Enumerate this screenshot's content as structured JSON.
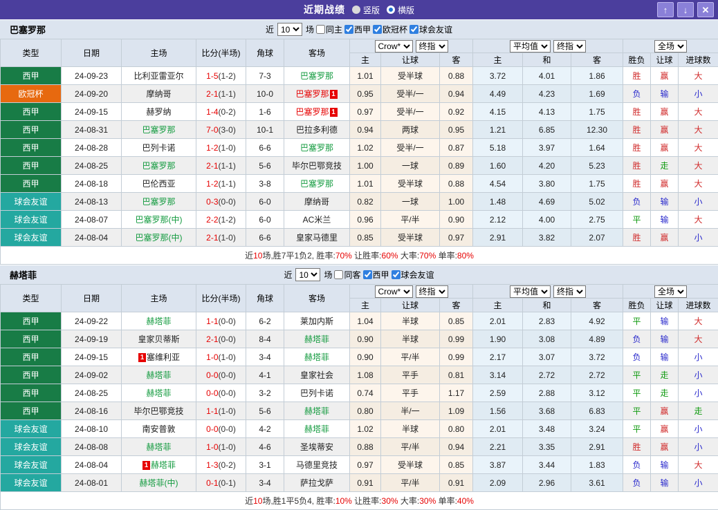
{
  "titlebar": {
    "title": "近期战绩",
    "view_options": [
      {
        "label": "竖版",
        "selected": false
      },
      {
        "label": "横版",
        "selected": true
      }
    ],
    "buttons": {
      "up": "↑",
      "down": "↓",
      "close": "✕"
    }
  },
  "colors": {
    "titlebar_bg": "#4b3e9d",
    "header_bg": "#dce4ef",
    "league": {
      "西甲": "#187c46",
      "欧冠杯": "#e7690f",
      "球会友谊": "#24a8a0"
    },
    "team_green": "#129a3e",
    "team_red": "#e60000",
    "score_red": "#e60000",
    "win_red": "#d02b2b",
    "lose_blue": "#2929cc",
    "draw_green": "#0f9a0f"
  },
  "table_header": {
    "static": [
      "类型",
      "日期",
      "主场",
      "比分(半场)",
      "角球",
      "客场"
    ],
    "group1_selects": [
      "Crow*",
      "终指"
    ],
    "group2_selects": [
      "平均值",
      "终指"
    ],
    "group3_select": "全场",
    "sub": [
      "主",
      "让球",
      "客",
      "主",
      "和",
      "客",
      "胜负",
      "让球",
      "进球数"
    ]
  },
  "filter_labels": {
    "near": "近",
    "count": "10",
    "games": "场"
  },
  "sections": [
    {
      "team": "巴塞罗那",
      "filter": {
        "same": {
          "label": "同主",
          "checked": false
        },
        "leagues": [
          {
            "label": "西甲",
            "checked": true
          },
          {
            "label": "欧冠杯",
            "checked": true
          },
          {
            "label": "球会友谊",
            "checked": true
          }
        ]
      },
      "rows": [
        {
          "league": "西甲",
          "date": "24-09-23",
          "home": {
            "text": "比利亚雷亚尔",
            "color": "black"
          },
          "score_full": "1-5",
          "score_half": "(1-2)",
          "corner": "7-3",
          "away": {
            "text": "巴塞罗那",
            "color": "green"
          },
          "odds": [
            "1.01",
            "受半球",
            "0.88"
          ],
          "avg": [
            "3.72",
            "4.01",
            "1.86"
          ],
          "verdict": [
            {
              "t": "胜",
              "c": "red"
            },
            {
              "t": "赢",
              "c": "red"
            },
            {
              "t": "大",
              "c": "red"
            }
          ]
        },
        {
          "league": "欧冠杯",
          "date": "24-09-20",
          "home": {
            "text": "摩纳哥",
            "color": "black"
          },
          "score_full": "2-1",
          "score_half": "(1-1)",
          "corner": "10-0",
          "away": {
            "text": "巴塞罗那",
            "color": "red",
            "badge": "1",
            "badge_pos": "after"
          },
          "odds": [
            "0.95",
            "受半/一",
            "0.94"
          ],
          "avg": [
            "4.49",
            "4.23",
            "1.69"
          ],
          "verdict": [
            {
              "t": "负",
              "c": "blue"
            },
            {
              "t": "输",
              "c": "blue"
            },
            {
              "t": "小",
              "c": "blue"
            }
          ]
        },
        {
          "league": "西甲",
          "date": "24-09-15",
          "home": {
            "text": "赫罗纳",
            "color": "black"
          },
          "score_full": "1-4",
          "score_half": "(0-2)",
          "corner": "1-6",
          "away": {
            "text": "巴塞罗那",
            "color": "red",
            "badge": "1",
            "badge_pos": "after"
          },
          "odds": [
            "0.97",
            "受半/一",
            "0.92"
          ],
          "avg": [
            "4.15",
            "4.13",
            "1.75"
          ],
          "verdict": [
            {
              "t": "胜",
              "c": "red"
            },
            {
              "t": "赢",
              "c": "red"
            },
            {
              "t": "大",
              "c": "red"
            }
          ]
        },
        {
          "league": "西甲",
          "date": "24-08-31",
          "home": {
            "text": "巴塞罗那",
            "color": "green"
          },
          "score_full": "7-0",
          "score_half": "(3-0)",
          "corner": "10-1",
          "away": {
            "text": "巴拉多利德",
            "color": "black"
          },
          "odds": [
            "0.94",
            "两球",
            "0.95"
          ],
          "avg": [
            "1.21",
            "6.85",
            "12.30"
          ],
          "verdict": [
            {
              "t": "胜",
              "c": "red"
            },
            {
              "t": "赢",
              "c": "red"
            },
            {
              "t": "大",
              "c": "red"
            }
          ]
        },
        {
          "league": "西甲",
          "date": "24-08-28",
          "home": {
            "text": "巴列卡诺",
            "color": "black"
          },
          "score_full": "1-2",
          "score_half": "(1-0)",
          "corner": "6-6",
          "away": {
            "text": "巴塞罗那",
            "color": "green"
          },
          "odds": [
            "1.02",
            "受半/一",
            "0.87"
          ],
          "avg": [
            "5.18",
            "3.97",
            "1.64"
          ],
          "verdict": [
            {
              "t": "胜",
              "c": "red"
            },
            {
              "t": "赢",
              "c": "red"
            },
            {
              "t": "大",
              "c": "red"
            }
          ]
        },
        {
          "league": "西甲",
          "date": "24-08-25",
          "home": {
            "text": "巴塞罗那",
            "color": "green"
          },
          "score_full": "2-1",
          "score_half": "(1-1)",
          "corner": "5-6",
          "away": {
            "text": "毕尔巴鄂竞技",
            "color": "black"
          },
          "odds": [
            "1.00",
            "一球",
            "0.89"
          ],
          "avg": [
            "1.60",
            "4.20",
            "5.23"
          ],
          "verdict": [
            {
              "t": "胜",
              "c": "red"
            },
            {
              "t": "走",
              "c": "green"
            },
            {
              "t": "大",
              "c": "red"
            }
          ]
        },
        {
          "league": "西甲",
          "date": "24-08-18",
          "home": {
            "text": "巴伦西亚",
            "color": "black"
          },
          "score_full": "1-2",
          "score_half": "(1-1)",
          "corner": "3-8",
          "away": {
            "text": "巴塞罗那",
            "color": "green"
          },
          "odds": [
            "1.01",
            "受半球",
            "0.88"
          ],
          "avg": [
            "4.54",
            "3.80",
            "1.75"
          ],
          "verdict": [
            {
              "t": "胜",
              "c": "red"
            },
            {
              "t": "赢",
              "c": "red"
            },
            {
              "t": "大",
              "c": "red"
            }
          ]
        },
        {
          "league": "球会友谊",
          "date": "24-08-13",
          "home": {
            "text": "巴塞罗那",
            "color": "green"
          },
          "score_full": "0-3",
          "score_half": "(0-0)",
          "corner": "6-0",
          "away": {
            "text": "摩纳哥",
            "color": "black"
          },
          "odds": [
            "0.82",
            "一球",
            "1.00"
          ],
          "avg": [
            "1.48",
            "4.69",
            "5.02"
          ],
          "verdict": [
            {
              "t": "负",
              "c": "blue"
            },
            {
              "t": "输",
              "c": "blue"
            },
            {
              "t": "小",
              "c": "blue"
            }
          ]
        },
        {
          "league": "球会友谊",
          "date": "24-08-07",
          "home": {
            "text": "巴塞罗那(中)",
            "color": "green"
          },
          "score_full": "2-2",
          "score_half": "(1-2)",
          "corner": "6-0",
          "away": {
            "text": "AC米兰",
            "color": "black"
          },
          "odds": [
            "0.96",
            "平/半",
            "0.90"
          ],
          "avg": [
            "2.12",
            "4.00",
            "2.75"
          ],
          "verdict": [
            {
              "t": "平",
              "c": "green"
            },
            {
              "t": "输",
              "c": "blue"
            },
            {
              "t": "大",
              "c": "red"
            }
          ]
        },
        {
          "league": "球会友谊",
          "date": "24-08-04",
          "home": {
            "text": "巴塞罗那(中)",
            "color": "green"
          },
          "score_full": "2-1",
          "score_half": "(1-0)",
          "corner": "6-6",
          "away": {
            "text": "皇家马德里",
            "color": "black"
          },
          "odds": [
            "0.85",
            "受半球",
            "0.97"
          ],
          "avg": [
            "2.91",
            "3.82",
            "2.07"
          ],
          "verdict": [
            {
              "t": "胜",
              "c": "red"
            },
            {
              "t": "赢",
              "c": "red"
            },
            {
              "t": "小",
              "c": "blue"
            }
          ]
        }
      ],
      "summary": [
        "近",
        "10",
        "场,胜7平1负2, 胜率:",
        "70%",
        " 让胜率:",
        "60%",
        " 大率:",
        "70%",
        " 单率:",
        "80%"
      ]
    },
    {
      "team": "赫塔菲",
      "filter": {
        "same": {
          "label": "同客",
          "checked": false
        },
        "leagues": [
          {
            "label": "西甲",
            "checked": true
          },
          {
            "label": "球会友谊",
            "checked": true
          }
        ]
      },
      "rows": [
        {
          "league": "西甲",
          "date": "24-09-22",
          "home": {
            "text": "赫塔菲",
            "color": "green"
          },
          "score_full": "1-1",
          "score_half": "(0-0)",
          "corner": "6-2",
          "away": {
            "text": "莱加内斯",
            "color": "black"
          },
          "odds": [
            "1.04",
            "半球",
            "0.85"
          ],
          "avg": [
            "2.01",
            "2.83",
            "4.92"
          ],
          "verdict": [
            {
              "t": "平",
              "c": "green"
            },
            {
              "t": "输",
              "c": "blue"
            },
            {
              "t": "大",
              "c": "red"
            }
          ]
        },
        {
          "league": "西甲",
          "date": "24-09-19",
          "home": {
            "text": "皇家贝蒂斯",
            "color": "black"
          },
          "score_full": "2-1",
          "score_half": "(0-0)",
          "corner": "8-4",
          "away": {
            "text": "赫塔菲",
            "color": "green"
          },
          "odds": [
            "0.90",
            "半球",
            "0.99"
          ],
          "avg": [
            "1.90",
            "3.08",
            "4.89"
          ],
          "verdict": [
            {
              "t": "负",
              "c": "blue"
            },
            {
              "t": "输",
              "c": "blue"
            },
            {
              "t": "大",
              "c": "red"
            }
          ]
        },
        {
          "league": "西甲",
          "date": "24-09-15",
          "home": {
            "text": "塞维利亚",
            "color": "black",
            "badge": "1",
            "badge_pos": "before"
          },
          "score_full": "1-0",
          "score_half": "(1-0)",
          "corner": "3-4",
          "away": {
            "text": "赫塔菲",
            "color": "green"
          },
          "odds": [
            "0.90",
            "平/半",
            "0.99"
          ],
          "avg": [
            "2.17",
            "3.07",
            "3.72"
          ],
          "verdict": [
            {
              "t": "负",
              "c": "blue"
            },
            {
              "t": "输",
              "c": "blue"
            },
            {
              "t": "小",
              "c": "blue"
            }
          ]
        },
        {
          "league": "西甲",
          "date": "24-09-02",
          "home": {
            "text": "赫塔菲",
            "color": "green"
          },
          "score_full": "0-0",
          "score_half": "(0-0)",
          "corner": "4-1",
          "away": {
            "text": "皇家社会",
            "color": "black"
          },
          "odds": [
            "1.08",
            "平手",
            "0.81"
          ],
          "avg": [
            "3.14",
            "2.72",
            "2.72"
          ],
          "verdict": [
            {
              "t": "平",
              "c": "green"
            },
            {
              "t": "走",
              "c": "green"
            },
            {
              "t": "小",
              "c": "blue"
            }
          ]
        },
        {
          "league": "西甲",
          "date": "24-08-25",
          "home": {
            "text": "赫塔菲",
            "color": "green"
          },
          "score_full": "0-0",
          "score_half": "(0-0)",
          "corner": "3-2",
          "away": {
            "text": "巴列卡诺",
            "color": "black"
          },
          "odds": [
            "0.74",
            "平手",
            "1.17"
          ],
          "avg": [
            "2.59",
            "2.88",
            "3.12"
          ],
          "verdict": [
            {
              "t": "平",
              "c": "green"
            },
            {
              "t": "走",
              "c": "green"
            },
            {
              "t": "小",
              "c": "blue"
            }
          ]
        },
        {
          "league": "西甲",
          "date": "24-08-16",
          "home": {
            "text": "毕尔巴鄂竞技",
            "color": "black"
          },
          "score_full": "1-1",
          "score_half": "(1-0)",
          "corner": "5-6",
          "away": {
            "text": "赫塔菲",
            "color": "green"
          },
          "odds": [
            "0.80",
            "半/一",
            "1.09"
          ],
          "avg": [
            "1.56",
            "3.68",
            "6.83"
          ],
          "verdict": [
            {
              "t": "平",
              "c": "green"
            },
            {
              "t": "赢",
              "c": "red"
            },
            {
              "t": "走",
              "c": "green"
            }
          ]
        },
        {
          "league": "球会友谊",
          "date": "24-08-10",
          "home": {
            "text": "南安普敦",
            "color": "black"
          },
          "score_full": "0-0",
          "score_half": "(0-0)",
          "corner": "4-2",
          "away": {
            "text": "赫塔菲",
            "color": "green"
          },
          "odds": [
            "1.02",
            "半球",
            "0.80"
          ],
          "avg": [
            "2.01",
            "3.48",
            "3.24"
          ],
          "verdict": [
            {
              "t": "平",
              "c": "green"
            },
            {
              "t": "赢",
              "c": "red"
            },
            {
              "t": "小",
              "c": "blue"
            }
          ]
        },
        {
          "league": "球会友谊",
          "date": "24-08-08",
          "home": {
            "text": "赫塔菲",
            "color": "green"
          },
          "score_full": "1-0",
          "score_half": "(1-0)",
          "corner": "4-6",
          "away": {
            "text": "圣埃蒂安",
            "color": "black"
          },
          "odds": [
            "0.88",
            "平/半",
            "0.94"
          ],
          "avg": [
            "2.21",
            "3.35",
            "2.91"
          ],
          "verdict": [
            {
              "t": "胜",
              "c": "red"
            },
            {
              "t": "赢",
              "c": "red"
            },
            {
              "t": "小",
              "c": "blue"
            }
          ]
        },
        {
          "league": "球会友谊",
          "date": "24-08-04",
          "home": {
            "text": "赫塔菲",
            "color": "green",
            "badge": "1",
            "badge_pos": "before"
          },
          "score_full": "1-3",
          "score_half": "(0-2)",
          "corner": "3-1",
          "away": {
            "text": "马德里竞技",
            "color": "black"
          },
          "odds": [
            "0.97",
            "受半球",
            "0.85"
          ],
          "avg": [
            "3.87",
            "3.44",
            "1.83"
          ],
          "verdict": [
            {
              "t": "负",
              "c": "blue"
            },
            {
              "t": "输",
              "c": "blue"
            },
            {
              "t": "大",
              "c": "red"
            }
          ]
        },
        {
          "league": "球会友谊",
          "date": "24-08-01",
          "home": {
            "text": "赫塔菲(中)",
            "color": "green"
          },
          "score_full": "0-1",
          "score_half": "(0-1)",
          "corner": "3-4",
          "away": {
            "text": "萨拉戈萨",
            "color": "black"
          },
          "odds": [
            "0.91",
            "平/半",
            "0.91"
          ],
          "avg": [
            "2.09",
            "2.96",
            "3.61"
          ],
          "verdict": [
            {
              "t": "负",
              "c": "blue"
            },
            {
              "t": "输",
              "c": "blue"
            },
            {
              "t": "小",
              "c": "blue"
            }
          ]
        }
      ],
      "summary": [
        "近",
        "10",
        "场,胜1平5负4, 胜率:",
        "10%",
        " 让胜率:",
        "30%",
        " 大率:",
        "30%",
        " 单率:",
        "40%"
      ]
    }
  ]
}
